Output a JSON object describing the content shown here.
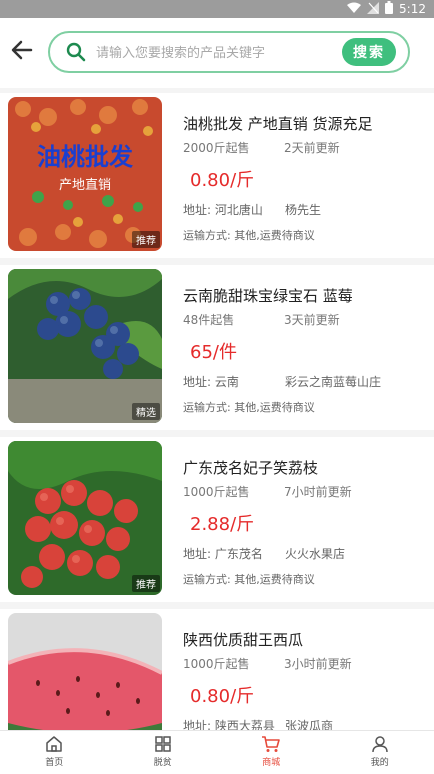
{
  "status": {
    "time": "5:12"
  },
  "search": {
    "placeholder": "请输入您要搜索的产品关键字",
    "button": "搜索"
  },
  "products": [
    {
      "title": "油桃批发 产地直销 货源充足",
      "min_order": "2000斤起售",
      "updated": "2天前更新",
      "price": "0.80/斤",
      "address": "地址: 河北唐山",
      "seller": "杨先生",
      "shipping": "运输方式: 其他,运费待商议",
      "badge": "推荐",
      "image_caption": [
        "油桃批发",
        "产地直销"
      ]
    },
    {
      "title": "云南脆甜珠宝绿宝石 蓝莓",
      "min_order": "48件起售",
      "updated": "3天前更新",
      "price": "65/件",
      "address": "地址: 云南",
      "seller": "彩云之南蓝莓山庄",
      "shipping": "运输方式: 其他,运费待商议",
      "badge": "精选"
    },
    {
      "title": "广东茂名妃子笑荔枝",
      "min_order": "1000斤起售",
      "updated": "7小时前更新",
      "price": "2.88/斤",
      "address": "地址: 广东茂名",
      "seller": "火火水果店",
      "shipping": "运输方式: 其他,运费待商议",
      "badge": "推荐"
    },
    {
      "title": "陕西优质甜王西瓜",
      "min_order": "1000斤起售",
      "updated": "3小时前更新",
      "price": "0.80/斤",
      "address": "地址: 陕西大荔县",
      "seller": "张波瓜商",
      "shipping": "",
      "badge": ""
    }
  ],
  "tabs": [
    {
      "label": "首页",
      "icon": "home-icon"
    },
    {
      "label": "脱贫",
      "icon": "grid-icon"
    },
    {
      "label": "商城",
      "icon": "cart-icon"
    },
    {
      "label": "我的",
      "icon": "user-icon"
    }
  ],
  "colors": {
    "accent": "#3fbf7e",
    "price": "#e52b2b",
    "tab_active": "#e64a3b"
  }
}
